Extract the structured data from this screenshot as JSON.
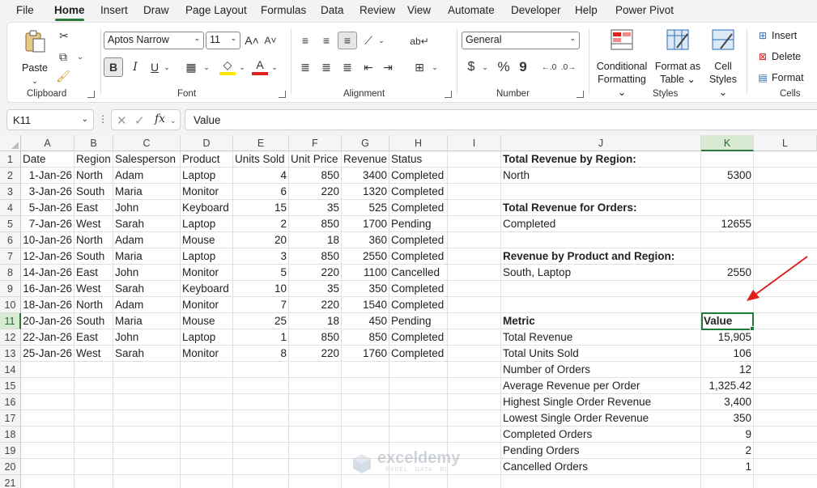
{
  "menu": {
    "tabs": [
      "File",
      "Home",
      "Insert",
      "Draw",
      "Page Layout",
      "Formulas",
      "Data",
      "Review",
      "View",
      "Automate",
      "Developer",
      "Help",
      "Power Pivot"
    ],
    "active": "Home"
  },
  "ribbon": {
    "clipboard": {
      "paste_label": "Paste",
      "group_label": "Clipboard"
    },
    "font": {
      "font_name": "Aptos Narrow",
      "font_size": "11",
      "bold": "B",
      "italic": "I",
      "underline": "U",
      "group_label": "Font"
    },
    "alignment": {
      "group_label": "Alignment"
    },
    "number": {
      "format": "General",
      "currency": "$",
      "percent": "%",
      "comma": "9",
      "group_label": "Number"
    },
    "styles": {
      "conditional": "Conditional",
      "conditional2": "Formatting",
      "format_as": "Format as",
      "format_as2": "Table",
      "cell_styles": "Cell",
      "cell_styles2": "Styles",
      "group_label": "Styles"
    },
    "cells": {
      "insert": "Insert",
      "delete": "Delete",
      "format": "Format",
      "group_label": "Cells"
    }
  },
  "formula_bar": {
    "name_box": "K11",
    "fx": "fx",
    "formula": "Value"
  },
  "grid": {
    "columns": [
      "A",
      "B",
      "C",
      "D",
      "E",
      "F",
      "G",
      "H",
      "I",
      "J",
      "K",
      "L"
    ],
    "rows": [
      "1",
      "2",
      "3",
      "4",
      "5",
      "6",
      "7",
      "8",
      "9",
      "10",
      "11",
      "12",
      "13",
      "14",
      "15",
      "16",
      "17",
      "18",
      "19",
      "20",
      "21"
    ],
    "headers": [
      "Date",
      "Region",
      "Salesperson",
      "Product",
      "Units Sold",
      "Unit Price",
      "Revenue",
      "Status"
    ],
    "data": [
      [
        "1-Jan-26",
        "North",
        "Adam",
        "Laptop",
        "4",
        "850",
        "3400",
        "Completed"
      ],
      [
        "3-Jan-26",
        "South",
        "Maria",
        "Monitor",
        "6",
        "220",
        "1320",
        "Completed"
      ],
      [
        "5-Jan-26",
        "East",
        "John",
        "Keyboard",
        "15",
        "35",
        "525",
        "Completed"
      ],
      [
        "7-Jan-26",
        "West",
        "Sarah",
        "Laptop",
        "2",
        "850",
        "1700",
        "Pending"
      ],
      [
        "10-Jan-26",
        "North",
        "Adam",
        "Mouse",
        "20",
        "18",
        "360",
        "Completed"
      ],
      [
        "12-Jan-26",
        "South",
        "Maria",
        "Laptop",
        "3",
        "850",
        "2550",
        "Completed"
      ],
      [
        "14-Jan-26",
        "East",
        "John",
        "Monitor",
        "5",
        "220",
        "1100",
        "Cancelled"
      ],
      [
        "16-Jan-26",
        "West",
        "Sarah",
        "Keyboard",
        "10",
        "35",
        "350",
        "Completed"
      ],
      [
        "18-Jan-26",
        "North",
        "Adam",
        "Monitor",
        "7",
        "220",
        "1540",
        "Completed"
      ],
      [
        "20-Jan-26",
        "South",
        "Maria",
        "Mouse",
        "25",
        "18",
        "450",
        "Pending"
      ],
      [
        "22-Jan-26",
        "East",
        "John",
        "Laptop",
        "1",
        "850",
        "850",
        "Completed"
      ],
      [
        "25-Jan-26",
        "West",
        "Sarah",
        "Monitor",
        "8",
        "220",
        "1760",
        "Completed"
      ]
    ],
    "summary": {
      "region_title": "Total Revenue by Region:",
      "region_label": "North",
      "region_value": "5300",
      "orders_title": "Total Revenue for Orders:",
      "orders_label": "Completed",
      "orders_value": "12655",
      "prodreg_title": "Revenue by Product and Region:",
      "prodreg_label": "South, Laptop",
      "prodreg_value": "2550"
    },
    "metrics_header": [
      "Metric",
      "Value"
    ],
    "metrics": [
      [
        "Total Revenue",
        "15,905"
      ],
      [
        "Total Units Sold",
        "106"
      ],
      [
        "Number of Orders",
        "12"
      ],
      [
        "Average Revenue per Order",
        "1,325.42"
      ],
      [
        "Highest Single Order Revenue",
        "3,400"
      ],
      [
        "Lowest Single Order Revenue",
        "350"
      ],
      [
        "Completed Orders",
        "9"
      ],
      [
        "Pending Orders",
        "2"
      ],
      [
        "Cancelled Orders",
        "1"
      ]
    ]
  },
  "watermark": {
    "name": "exceldemy",
    "tagline": "EXCEL · DATA · BI"
  },
  "colors": {
    "accent": "#2b7a3b",
    "arrow": "#e0201b"
  }
}
